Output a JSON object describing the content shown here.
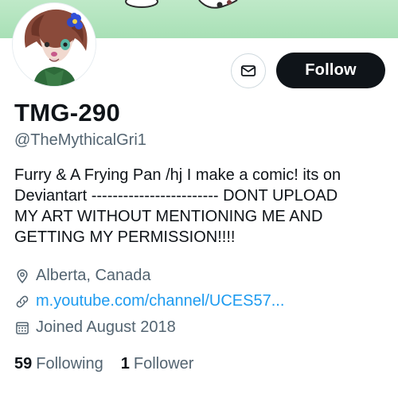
{
  "profile": {
    "display_name": "TMG-290",
    "handle": "@TheMythicalGri1",
    "bio": "Furry & A Frying Pan /hj I make a comic! its on\nDeviantart  ------------------------  DONT UPLOAD\nMY ART WITHOUT MENTIONING ME AND\nGETTING MY PERMISSION!!!!",
    "location": "Alberta, Canada",
    "website": "m.youtube.com/channel/UCES57...",
    "joined": "Joined August 2018"
  },
  "actions": {
    "follow_label": "Follow",
    "message_icon": "envelope-icon"
  },
  "stats": {
    "following_count": "59",
    "following_label": "Following",
    "followers_count": "1",
    "followers_label": "Follower"
  },
  "icons": {
    "location": "location-pin-icon",
    "link": "link-icon",
    "joined": "calendar-icon"
  },
  "colors": {
    "banner": "#a8e0b6",
    "follow_bg": "#0f1419",
    "link": "#1d9bf0",
    "secondary_text": "#536471"
  }
}
